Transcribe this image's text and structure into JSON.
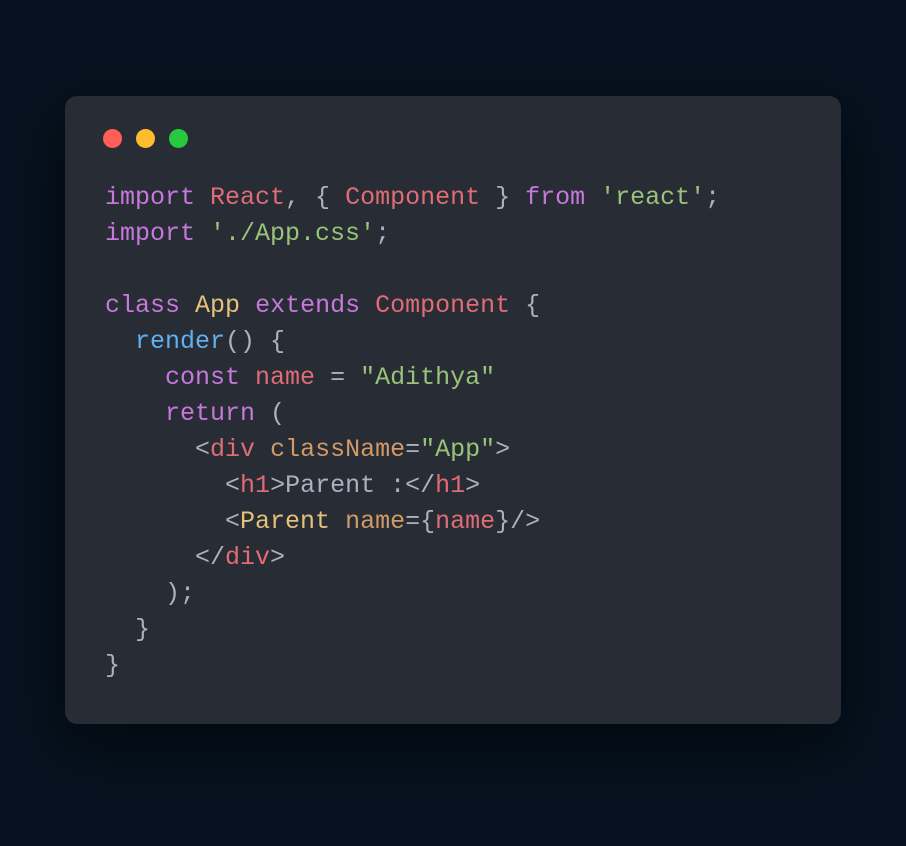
{
  "window": {
    "traffic_lights": [
      "close",
      "minimize",
      "zoom"
    ]
  },
  "code": {
    "line1": {
      "t1": "import",
      "t2": "React",
      "t3": ", { ",
      "t4": "Component",
      "t5": " } ",
      "t6": "from",
      "t7": " ",
      "t8": "'react'",
      "t9": ";"
    },
    "line2": {
      "t1": "import",
      "t2": " ",
      "t3": "'./App.css'",
      "t4": ";"
    },
    "line3": {
      "blank": ""
    },
    "line4": {
      "t1": "class",
      "t2": " ",
      "t3": "App",
      "t4": " ",
      "t5": "extends",
      "t6": " ",
      "t7": "Component",
      "t8": " ",
      "t9": "{"
    },
    "line5": {
      "indent": "  ",
      "t1": "render",
      "t2": "() ",
      "t3": "{"
    },
    "line6": {
      "indent": "    ",
      "t1": "const",
      "t2": " ",
      "t3": "name",
      "t4": " = ",
      "t5": "\"Adithya\""
    },
    "line7": {
      "indent": "    ",
      "t1": "return",
      "t2": " (",
      "t3": ""
    },
    "line8": {
      "indent": "      ",
      "t1": "<",
      "t2": "div",
      "t3": " ",
      "t4": "className",
      "t5": "=",
      "t6": "\"App\"",
      "t7": ">"
    },
    "line9": {
      "indent": "        ",
      "t1": "<",
      "t2": "h1",
      "t3": ">",
      "t4": "Parent :",
      "t5": "</",
      "t6": "h1",
      "t7": ">"
    },
    "line10": {
      "indent": "        ",
      "t1": "<",
      "t2": "Parent",
      "t3": " ",
      "t4": "name",
      "t5": "=",
      "t6": "{",
      "t7": "name",
      "t8": "}",
      "t9": "/>"
    },
    "line11": {
      "indent": "      ",
      "t1": "</",
      "t2": "div",
      "t3": ">"
    },
    "line12": {
      "indent": "    ",
      "t1": ");"
    },
    "line13": {
      "indent": "  ",
      "t1": "}"
    },
    "line14": {
      "t1": "}"
    }
  }
}
